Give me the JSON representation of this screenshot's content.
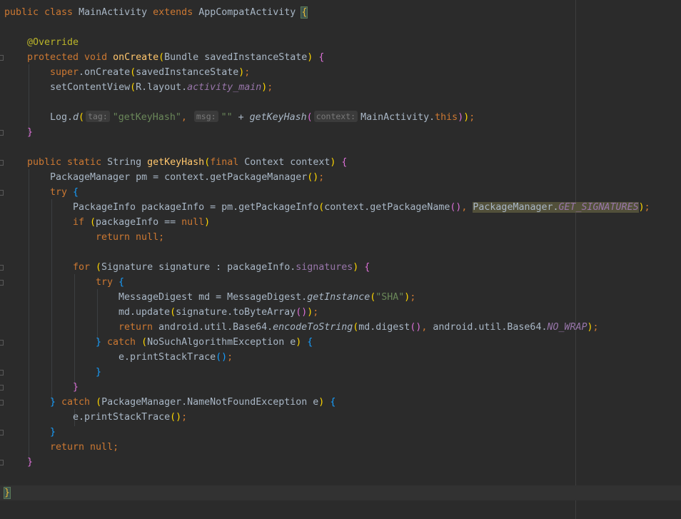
{
  "editor": {
    "lines": {
      "l1": {
        "kw1": "public class ",
        "cls": "MainActivity ",
        "kw2": "extends ",
        "base": "AppCompatActivity ",
        "brace": "{"
      },
      "l3": {
        "ann": "@Override"
      },
      "l4": {
        "kw": "protected void ",
        "fn": "onCreate",
        "open": "(",
        "args": "Bundle savedInstanceState",
        "close": ")",
        "brace": " {"
      },
      "l5": {
        "kw": "super",
        "rest1": ".onCreate",
        "open": "(",
        "args": "savedInstanceState",
        "close": ")",
        "end": ";"
      },
      "l6": {
        "call": "setContentView",
        "open": "(",
        "pre": "R.layout.",
        "fld": "activity_main",
        "close": ")",
        "end": ";"
      },
      "l8": {
        "obj": "Log.",
        "fn": "d",
        "open": "(",
        "hint_tag": "tag:",
        "str1": "\"getKeyHash\"",
        "comma1": ", ",
        "hint_msg": "msg:",
        "str2": "\"\"",
        "plus": " + ",
        "fn2": "getKeyHash",
        "open2": "(",
        "hint_ctx": "context:",
        "arg": "MainActivity.",
        "kw_this": "this",
        "close2": ")",
        "close": ")",
        "end": ";"
      },
      "l9": {
        "brace": "}"
      },
      "l11": {
        "kw1": "public static ",
        "type": "String ",
        "fn": "getKeyHash",
        "open": "(",
        "kw2": "final ",
        "args": "Context context",
        "close": ")",
        "brace": " {"
      },
      "l12": {
        "text": "PackageManager pm = context.getPackageManager",
        "parens": "()",
        "end": ";"
      },
      "l13": {
        "kw": "try ",
        "brace": "{"
      },
      "l14": {
        "text": "PackageInfo packageInfo = pm.getPackageInfo",
        "open": "(",
        "mid": "context.getPackageName",
        "parens": "()",
        "comma": ", ",
        "hl_cls": "PackageManager.",
        "hl_fld": "GET_SIGNATURES",
        "close": ")",
        "end": ";"
      },
      "l15": {
        "kw": "if ",
        "open": "(",
        "text": "packageInfo == ",
        "kw_null": "null",
        "close": ")"
      },
      "l16": {
        "kw": "return ",
        "kw_null": "null",
        "end": ";"
      },
      "l18": {
        "kw": "for ",
        "open": "(",
        "text": "Signature signature : packageInfo.",
        "fld": "signatures",
        "close": ")",
        "brace": " {"
      },
      "l19": {
        "kw": "try ",
        "brace": "{"
      },
      "l20": {
        "text": "MessageDigest md = MessageDigest.",
        "fn": "getInstance",
        "open": "(",
        "str": "\"SHA\"",
        "close": ")",
        "end": ";"
      },
      "l21": {
        "text": "md.update",
        "open": "(",
        "mid": "signature.toByteArray",
        "parens": "()",
        "close": ")",
        "end": ";"
      },
      "l22": {
        "kw": "return ",
        "text": "android.util.Base64.",
        "fn": "encodeToString",
        "open": "(",
        "mid": "md.digest",
        "parens": "()",
        "comma": ", ",
        "cls": "android.util.Base64.",
        "fld": "NO_WRAP",
        "close": ")",
        "end": ";"
      },
      "l23": {
        "brace": "} ",
        "kw": "catch ",
        "open": "(",
        "text": "NoSuchAlgorithmException e",
        "close": ")",
        "brace2": " {"
      },
      "l24": {
        "text": "e.printStackTrace",
        "parens": "()",
        "end": ";"
      },
      "l25": {
        "brace": "}"
      },
      "l26": {
        "brace": "}"
      },
      "l27": {
        "brace": "} ",
        "kw": "catch ",
        "open": "(",
        "text": "PackageManager.NameNotFoundException e",
        "close": ")",
        "brace2": " {"
      },
      "l28": {
        "text": "e.printStackTrace",
        "parens": "()",
        "end": ";"
      },
      "l29": {
        "brace": "}"
      },
      "l30": {
        "kw": "return ",
        "kw_null": "null",
        "end": ";"
      },
      "l31": {
        "brace": "}"
      },
      "l33": {
        "brace": "}"
      }
    }
  }
}
